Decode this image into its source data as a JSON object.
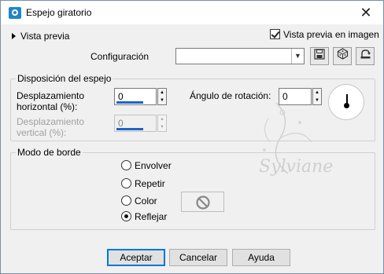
{
  "window": {
    "title": "Espejo giratorio",
    "close_glyph": "✕"
  },
  "top": {
    "preview_toggle": "Vista previa",
    "live_preview_label": "Vista previa en imagen",
    "live_preview_checked": true,
    "config_label": "Configuración",
    "config_value": "",
    "tool_icons": [
      "save-icon",
      "dice-icon",
      "reset-icon"
    ]
  },
  "mirror_group": {
    "title": "Disposición del espejo",
    "hshift_label_1": "Desplazamiento",
    "hshift_label_2": "horizontal (%):",
    "hshift_value": "0",
    "vshift_label_1": "Desplazamiento",
    "vshift_label_2": "vertical (%):",
    "vshift_value": "0",
    "angle_label": "Ángulo de rotación:",
    "angle_value": "0"
  },
  "border_group": {
    "title": "Modo de borde",
    "options": [
      {
        "label": "Envolver",
        "checked": false
      },
      {
        "label": "Repetir",
        "checked": false
      },
      {
        "label": "Color",
        "checked": false
      },
      {
        "label": "Reflejar",
        "checked": true
      }
    ]
  },
  "watermark": "Sylviane",
  "buttons": {
    "ok": "Aceptar",
    "cancel": "Cancelar",
    "help": "Ayuda"
  }
}
